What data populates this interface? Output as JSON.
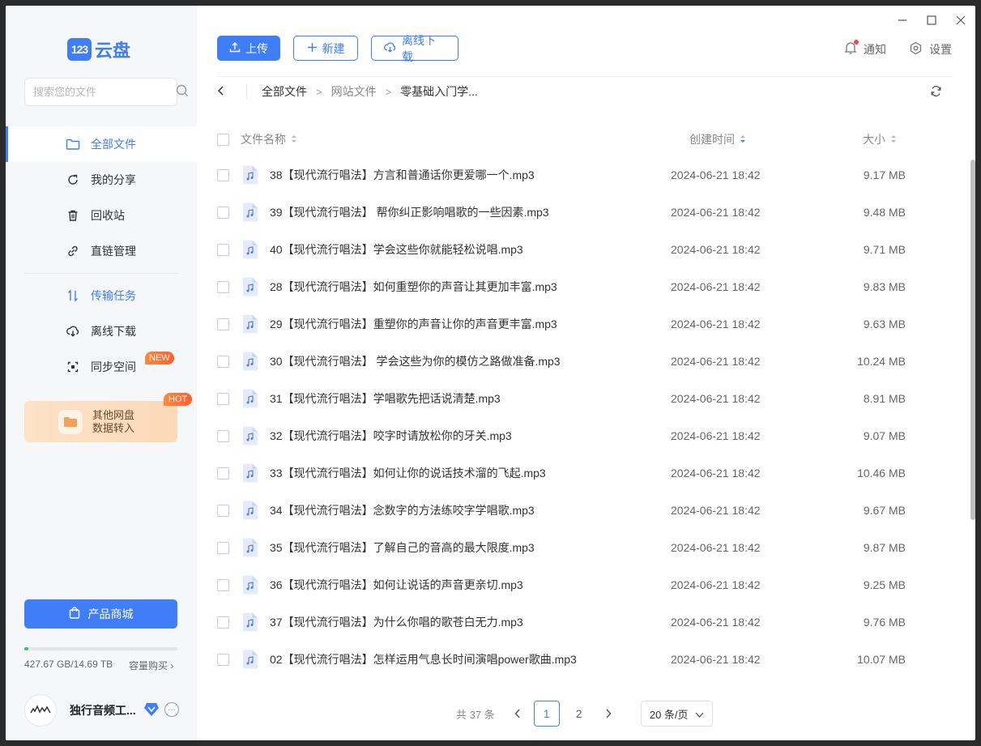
{
  "app": {
    "logo_mark": "123",
    "logo_text": "云盘"
  },
  "search": {
    "placeholder": "搜索您的文件"
  },
  "sidebar": {
    "items": [
      {
        "label": "全部文件"
      },
      {
        "label": "我的分享"
      },
      {
        "label": "回收站"
      },
      {
        "label": "直链管理"
      },
      {
        "label": "传输任务"
      },
      {
        "label": "离线下载"
      },
      {
        "label": "同步空间",
        "badge": "NEW"
      }
    ],
    "promo": {
      "line1": "其他网盘",
      "line2": "数据转入",
      "badge": "HOT"
    },
    "shop_label": "产品商城",
    "storage": {
      "used_fraction": 0.028,
      "text": "427.67 GB/14.69 TB",
      "buy_label": "容量购买"
    },
    "user": {
      "name": "独行音频工..."
    }
  },
  "toolbar": {
    "upload": "上传",
    "new": "新建",
    "offline": "离线下载"
  },
  "top_right": {
    "notify": "通知",
    "settings": "设置"
  },
  "breadcrumb": {
    "root": "全部文件",
    "level1": "网站文件",
    "level2": "零基础入门学..."
  },
  "table": {
    "headers": {
      "name": "文件名称",
      "time": "创建时间",
      "size": "大小"
    },
    "rows": [
      {
        "name": "38【现代流行唱法】方言和普通话你更爱哪一个.mp3",
        "time": "2024-06-21 18:42",
        "size": "9.17 MB"
      },
      {
        "name": "39【现代流行唱法】 帮你纠正影响唱歌的一些因素.mp3",
        "time": "2024-06-21 18:42",
        "size": "9.48 MB"
      },
      {
        "name": "40【现代流行唱法】学会这些你就能轻松说唱.mp3",
        "time": "2024-06-21 18:42",
        "size": "9.71 MB"
      },
      {
        "name": "28【现代流行唱法】如何重塑你的声音让其更加丰富.mp3",
        "time": "2024-06-21 18:42",
        "size": "9.83 MB"
      },
      {
        "name": "29【现代流行唱法】重塑你的声音让你的声音更丰富.mp3",
        "time": "2024-06-21 18:42",
        "size": "9.63 MB"
      },
      {
        "name": "30【现代流行唱法】 学会这些为你的模仿之路做准备.mp3",
        "time": "2024-06-21 18:42",
        "size": "10.24 MB"
      },
      {
        "name": "31【现代流行唱法】学唱歌先把话说清楚.mp3",
        "time": "2024-06-21 18:42",
        "size": "8.91 MB"
      },
      {
        "name": "32【现代流行唱法】咬字时请放松你的牙关.mp3",
        "time": "2024-06-21 18:42",
        "size": "9.07 MB"
      },
      {
        "name": "33【现代流行唱法】如何让你的说话技术溜的飞起.mp3",
        "time": "2024-06-21 18:42",
        "size": "10.46 MB"
      },
      {
        "name": "34【现代流行唱法】念数字的方法练咬字学唱歌.mp3",
        "time": "2024-06-21 18:42",
        "size": "9.67 MB"
      },
      {
        "name": "35【现代流行唱法】了解自己的音高的最大限度.mp3",
        "time": "2024-06-21 18:42",
        "size": "9.87 MB"
      },
      {
        "name": "36【现代流行唱法】如何让说话的声音更亲切.mp3",
        "time": "2024-06-21 18:42",
        "size": "9.25 MB"
      },
      {
        "name": "37【现代流行唱法】为什么你唱的歌苍白无力.mp3",
        "time": "2024-06-21 18:42",
        "size": "9.76 MB"
      },
      {
        "name": "02【现代流行唱法】怎样运用气息长时间演唱power歌曲.mp3",
        "time": "2024-06-21 18:42",
        "size": "10.07 MB"
      }
    ]
  },
  "pager": {
    "total": "共 37 条",
    "page1": "1",
    "page2": "2",
    "page_size": "20 条/页"
  },
  "colors": {
    "accent": "#3f7ef7",
    "sidebar_bg": "#f6f7f9"
  }
}
